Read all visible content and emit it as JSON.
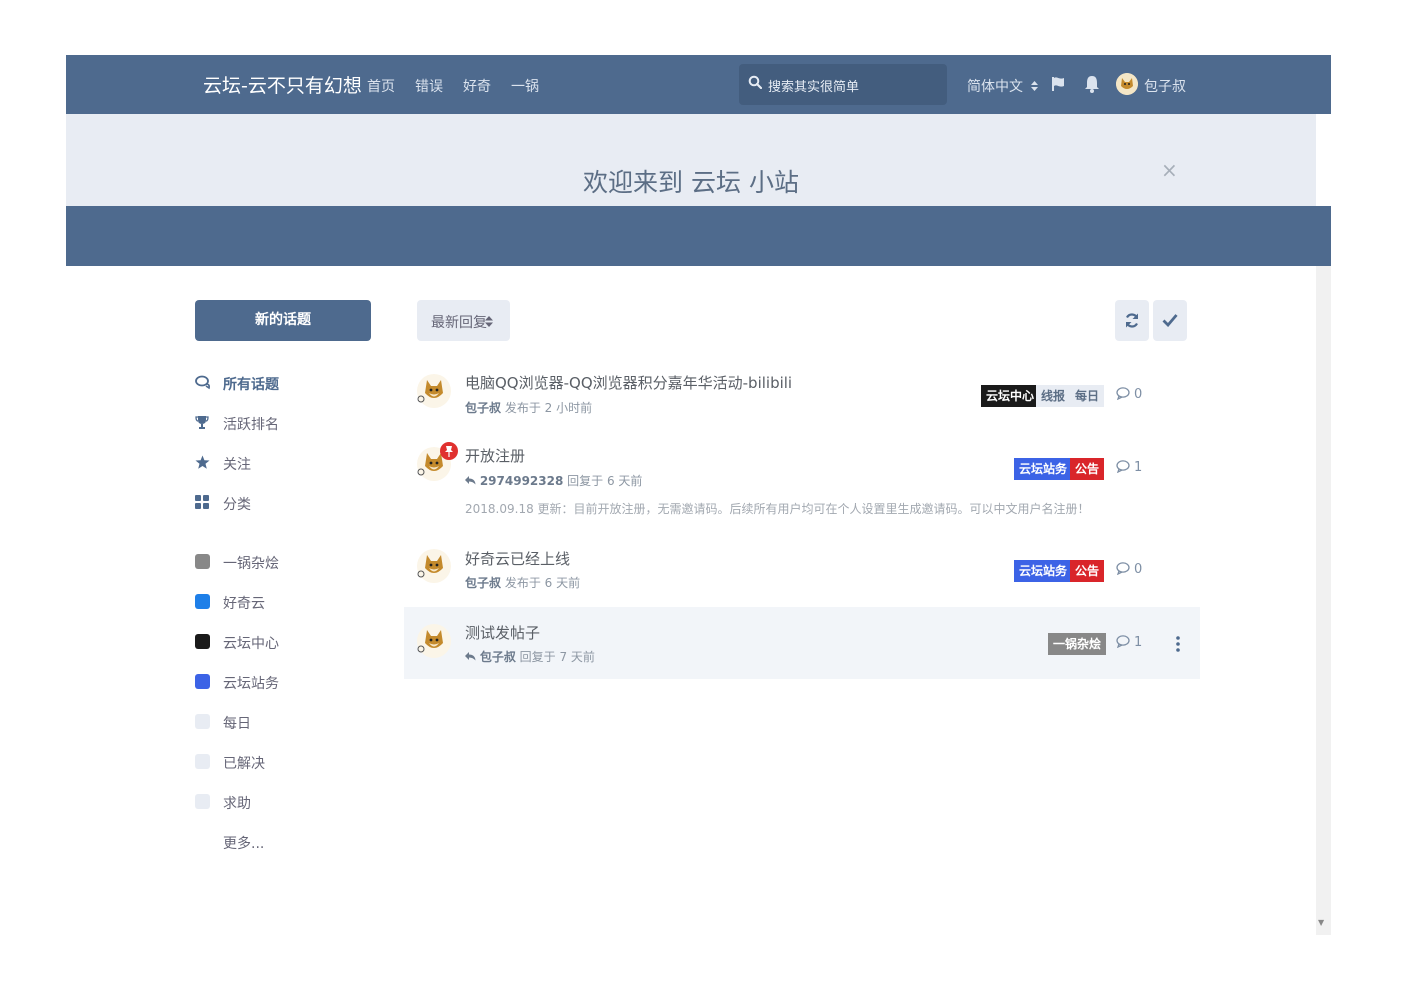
{
  "header": {
    "brand": "云坛-云不只有幻想",
    "nav": [
      "首页",
      "错误",
      "好奇",
      "一锅"
    ],
    "search_placeholder": "搜索其实很简单",
    "language": "简体中文",
    "username": "包子叔"
  },
  "hero": {
    "title": "欢迎来到 云坛 小站",
    "close": "×"
  },
  "sidebar": {
    "new_topic": "新的话题",
    "nav": [
      {
        "label": "所有话题",
        "icon": "comments-icon"
      },
      {
        "label": "活跃排名",
        "icon": "trophy-icon"
      },
      {
        "label": "关注",
        "icon": "star-icon"
      },
      {
        "label": "分类",
        "icon": "grid-icon"
      }
    ],
    "categories": [
      {
        "label": "一锅杂烩",
        "color": "#888888"
      },
      {
        "label": "好奇云",
        "color": "#1e7fe8"
      },
      {
        "label": "云坛中心",
        "color": "#1a1a1a"
      },
      {
        "label": "云坛站务",
        "color": "#3c63e6"
      },
      {
        "label": "每日",
        "color": "#e8ecf3"
      },
      {
        "label": "已解决",
        "color": "#e8ecf3"
      },
      {
        "label": "求助",
        "color": "#e8ecf3"
      }
    ],
    "more": "更多..."
  },
  "toolbar": {
    "sort_label": "最新回复"
  },
  "discussions": [
    {
      "title": "电脑QQ浏览器-QQ浏览器积分嘉年华活动-bilibili",
      "user": "包子叔",
      "action": "发布于 2 小时前",
      "tags": [
        {
          "label": "云坛中心",
          "bg": "#1a1a1a",
          "fg": "#ffffff"
        },
        {
          "label": "线报",
          "bg": "#e8ecf3",
          "fg": "#5c6e85"
        },
        {
          "label": "每日",
          "bg": "#e8ecf3",
          "fg": "#5c6e85"
        }
      ],
      "replies": "0"
    },
    {
      "title": "开放注册",
      "user": "2974992328",
      "action": "回复于 6 天前",
      "excerpt": "2018.09.18 更新：目前开放注册，无需邀请码。后续所有用户均可在个人设置里生成邀请码。可以中文用户名注册！",
      "tags": [
        {
          "label": "云坛站务",
          "bg": "#3c63e6",
          "fg": "#ffffff"
        },
        {
          "label": "公告",
          "bg": "#d9252a",
          "fg": "#ffffff"
        }
      ],
      "replies": "1"
    },
    {
      "title": "好奇云已经上线",
      "user": "包子叔",
      "action": "发布于 6 天前",
      "tags": [
        {
          "label": "云坛站务",
          "bg": "#3c63e6",
          "fg": "#ffffff"
        },
        {
          "label": "公告",
          "bg": "#d9252a",
          "fg": "#ffffff"
        }
      ],
      "replies": "0"
    },
    {
      "title": "测试发帖子",
      "user": "包子叔",
      "action": "回复于 7 天前",
      "tags": [
        {
          "label": "一锅杂烩",
          "bg": "#888888",
          "fg": "#ffffff"
        }
      ],
      "replies": "1"
    }
  ]
}
